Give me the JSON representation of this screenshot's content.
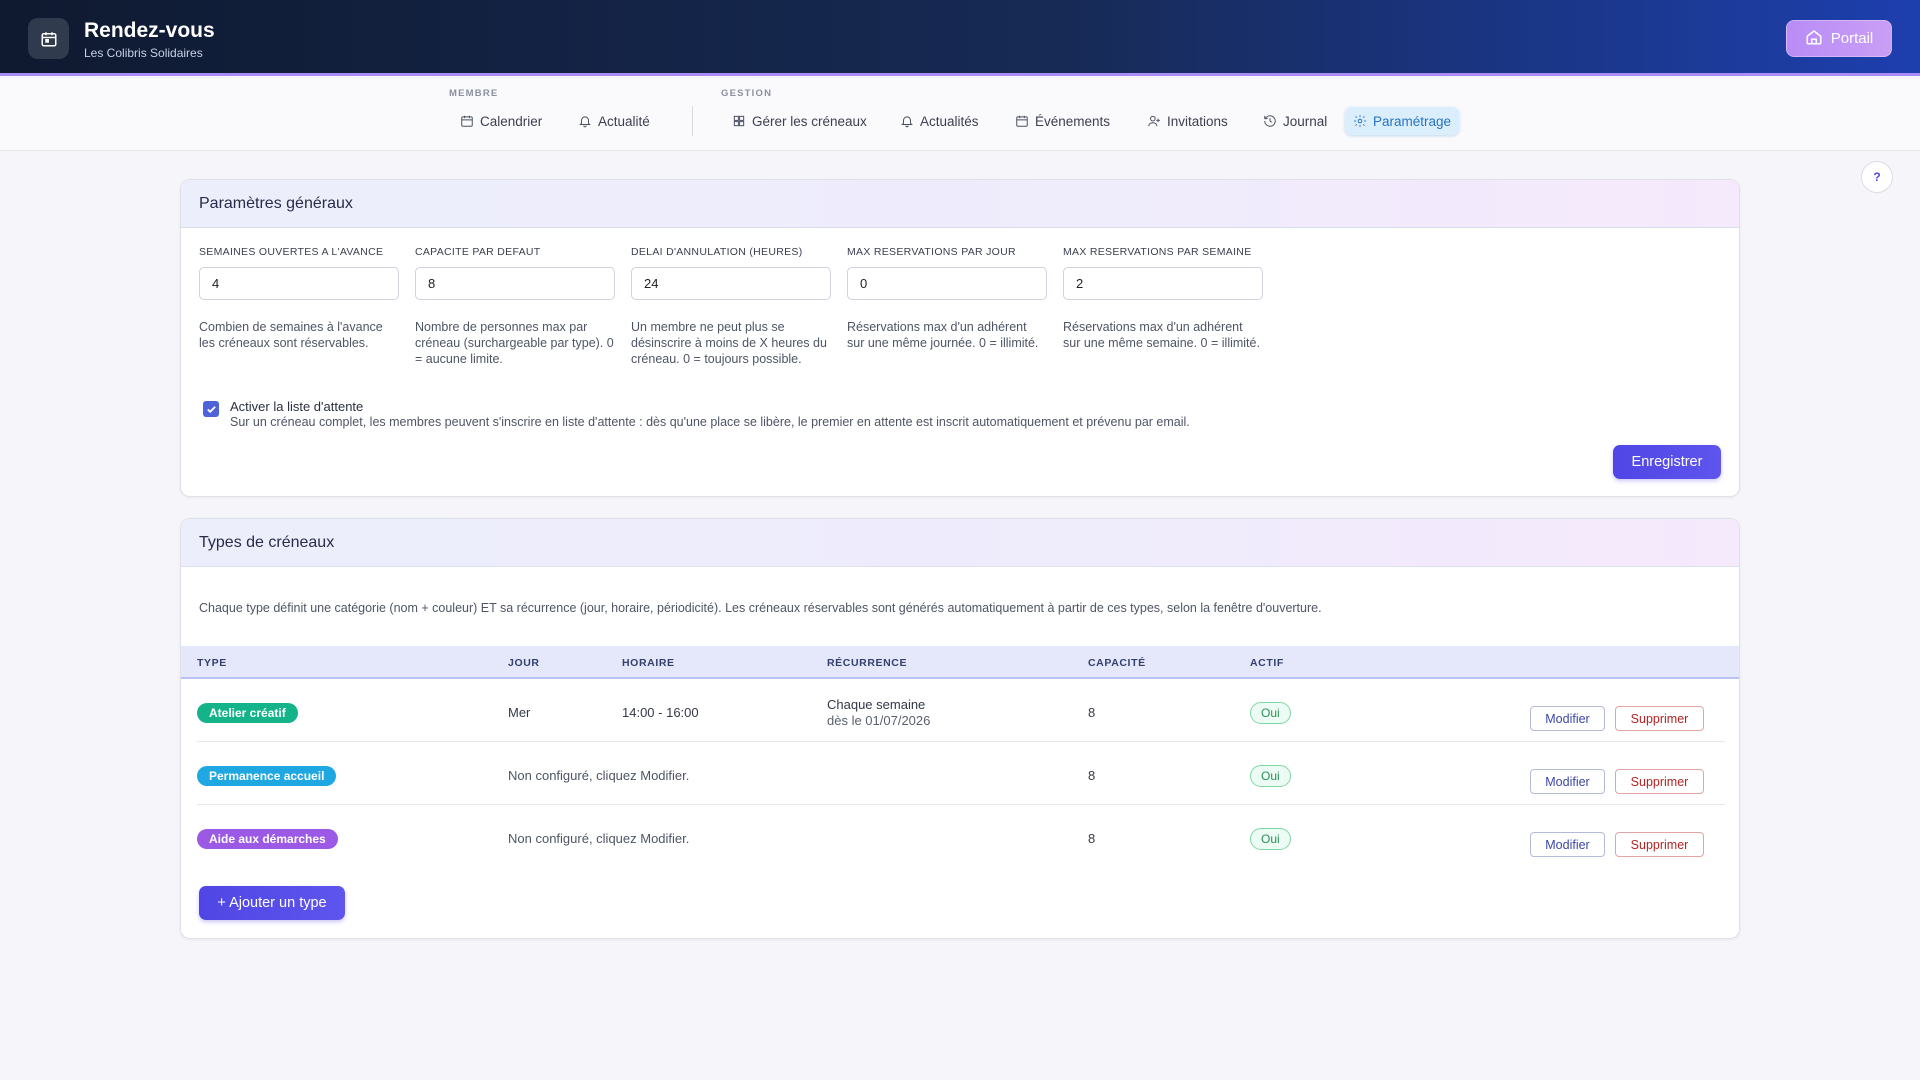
{
  "header": {
    "title": "Rendez-vous",
    "subtitle": "Les Colibris Solidaires",
    "portal_label": "Portail",
    "app_icon": "calendar-icon",
    "portal_icon": "home-icon"
  },
  "nav": {
    "group_member": "MEMBRE",
    "group_manage": "GESTION",
    "items": [
      {
        "label": "Calendrier",
        "icon": "calendar-icon"
      },
      {
        "label": "Actualité",
        "icon": "bell-icon"
      },
      {
        "label": "Gérer les créneaux",
        "icon": "grid-icon"
      },
      {
        "label": "Actualités",
        "icon": "bell-icon"
      },
      {
        "label": "Événements",
        "icon": "calendar-icon"
      },
      {
        "label": "Invitations",
        "icon": "user-plus-icon"
      },
      {
        "label": "Journal",
        "icon": "history-icon"
      },
      {
        "label": "Paramétrage",
        "icon": "gear-icon",
        "active": true
      }
    ]
  },
  "help_label": "?",
  "general": {
    "title": "Paramètres généraux",
    "fields": [
      {
        "label": "SEMAINES OUVERTES A L'AVANCE",
        "value": "4",
        "help": "Combien de semaines à l'avance les créneaux sont réservables."
      },
      {
        "label": "CAPACITE PAR DEFAUT",
        "value": "8",
        "help": "Nombre de personnes max par créneau (surchargeable par type). 0 = aucune limite."
      },
      {
        "label": "DELAI D'ANNULATION (HEURES)",
        "value": "24",
        "help": "Un membre ne peut plus se désinscrire à moins de X heures du créneau. 0 = toujours possible."
      },
      {
        "label": "MAX RESERVATIONS PAR JOUR",
        "value": "0",
        "help": "Réservations max d'un adhérent sur une même journée. 0 = illimité."
      },
      {
        "label": "MAX RESERVATIONS PAR SEMAINE",
        "value": "2",
        "help": "Réservations max d'un adhérent sur une même semaine. 0 = illimité."
      }
    ],
    "waitlist_checked": true,
    "waitlist_label": "Activer la liste d'attente",
    "waitlist_desc": "Sur un créneau complet, les membres peuvent s'inscrire en liste d'attente : dès qu'une place se libère, le premier en attente est inscrit automatiquement et prévenu par email.",
    "save_label": "Enregistrer"
  },
  "types": {
    "title": "Types de créneaux",
    "description": "Chaque type définit une catégorie (nom + couleur) ET sa récurrence (jour, horaire, périodicité). Les créneaux réservables sont générés automatiquement à partir de ces types, selon la fenêtre d'ouverture.",
    "columns": [
      "TYPE",
      "JOUR",
      "HORAIRE",
      "RÉCURRENCE",
      "CAPACITÉ",
      "ACTIF"
    ],
    "rows": [
      {
        "type": "Atelier créatif",
        "color": "#14b38a",
        "jour": "Mer",
        "horaire": "14:00 - 16:00",
        "recurrence": "Chaque semaine",
        "recurrence_since": "dès le 01/07/2026",
        "capacite": "8",
        "actif": "Oui"
      },
      {
        "type": "Permanence accueil",
        "color": "#1ea7e0",
        "jour": "Non configuré, cliquez Modifier.",
        "horaire": "",
        "recurrence": "",
        "recurrence_since": "",
        "capacite": "8",
        "actif": "Oui"
      },
      {
        "type": "Aide aux démarches",
        "color": "#9b59e6",
        "jour": "Non configuré, cliquez Modifier.",
        "horaire": "",
        "recurrence": "",
        "recurrence_since": "",
        "capacite": "8",
        "actif": "Oui"
      }
    ],
    "edit_label": "Modifier",
    "delete_label": "Supprimer",
    "add_label": "+ Ajouter un type"
  }
}
